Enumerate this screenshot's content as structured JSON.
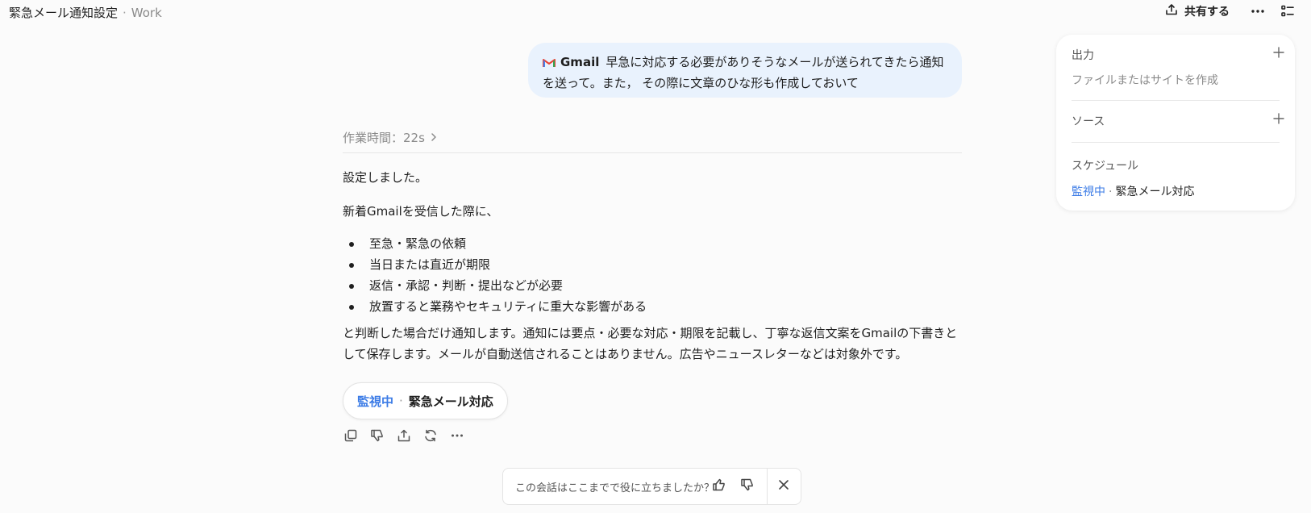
{
  "header": {
    "title": "緊急メール通知設定",
    "separator": "·",
    "workspace": "Work",
    "share_label": "共有する"
  },
  "user_message": {
    "app": "Gmail",
    "text": "早急に対応する必要がありそうなメールが送られてきたら通知を送って。また， その際に文章のひな形も作成しておいて"
  },
  "response": {
    "work_time": "作業時間：22s",
    "ack": "設定しました。",
    "intro": "新着Gmailを受信した際に、",
    "bullets": [
      "至急・緊急の依頼",
      "当日または直近が期限",
      "返信・承認・判断・提出などが必要",
      "放置すると業務やセキュリティに重大な影響がある"
    ],
    "body": "と判断した場合だけ通知します。通知には要点・必要な対応・期限を記載し、丁寧な返信文案をGmailの下書きとして保存します。メールが自動送信されることはありません。広告やニュースレターなどは対象外です。",
    "status": {
      "state": "監視中",
      "separator": "·",
      "name": "緊急メール対応"
    }
  },
  "feedback": {
    "question": "この会話はここまでで役に立ちましたか？"
  },
  "side_panel": {
    "output": {
      "title": "出力",
      "subtitle": "ファイルまたはサイトを作成"
    },
    "source": {
      "title": "ソース"
    },
    "schedule": {
      "title": "スケジュール",
      "state": "監視中",
      "separator": "·",
      "name": "緊急メール対応"
    }
  },
  "colors": {
    "accent_blue": "#3b7be6",
    "bubble_bg": "#e9f2fd",
    "gmail_red": "#ea4335"
  },
  "icons": [
    "share-icon",
    "more-icon",
    "panel-icon",
    "gmail-icon",
    "chevron-right-icon",
    "copy-icon",
    "thumbs-down-icon",
    "share-icon",
    "regenerate-icon",
    "thumbs-up-icon",
    "close-icon",
    "plus-icon"
  ]
}
